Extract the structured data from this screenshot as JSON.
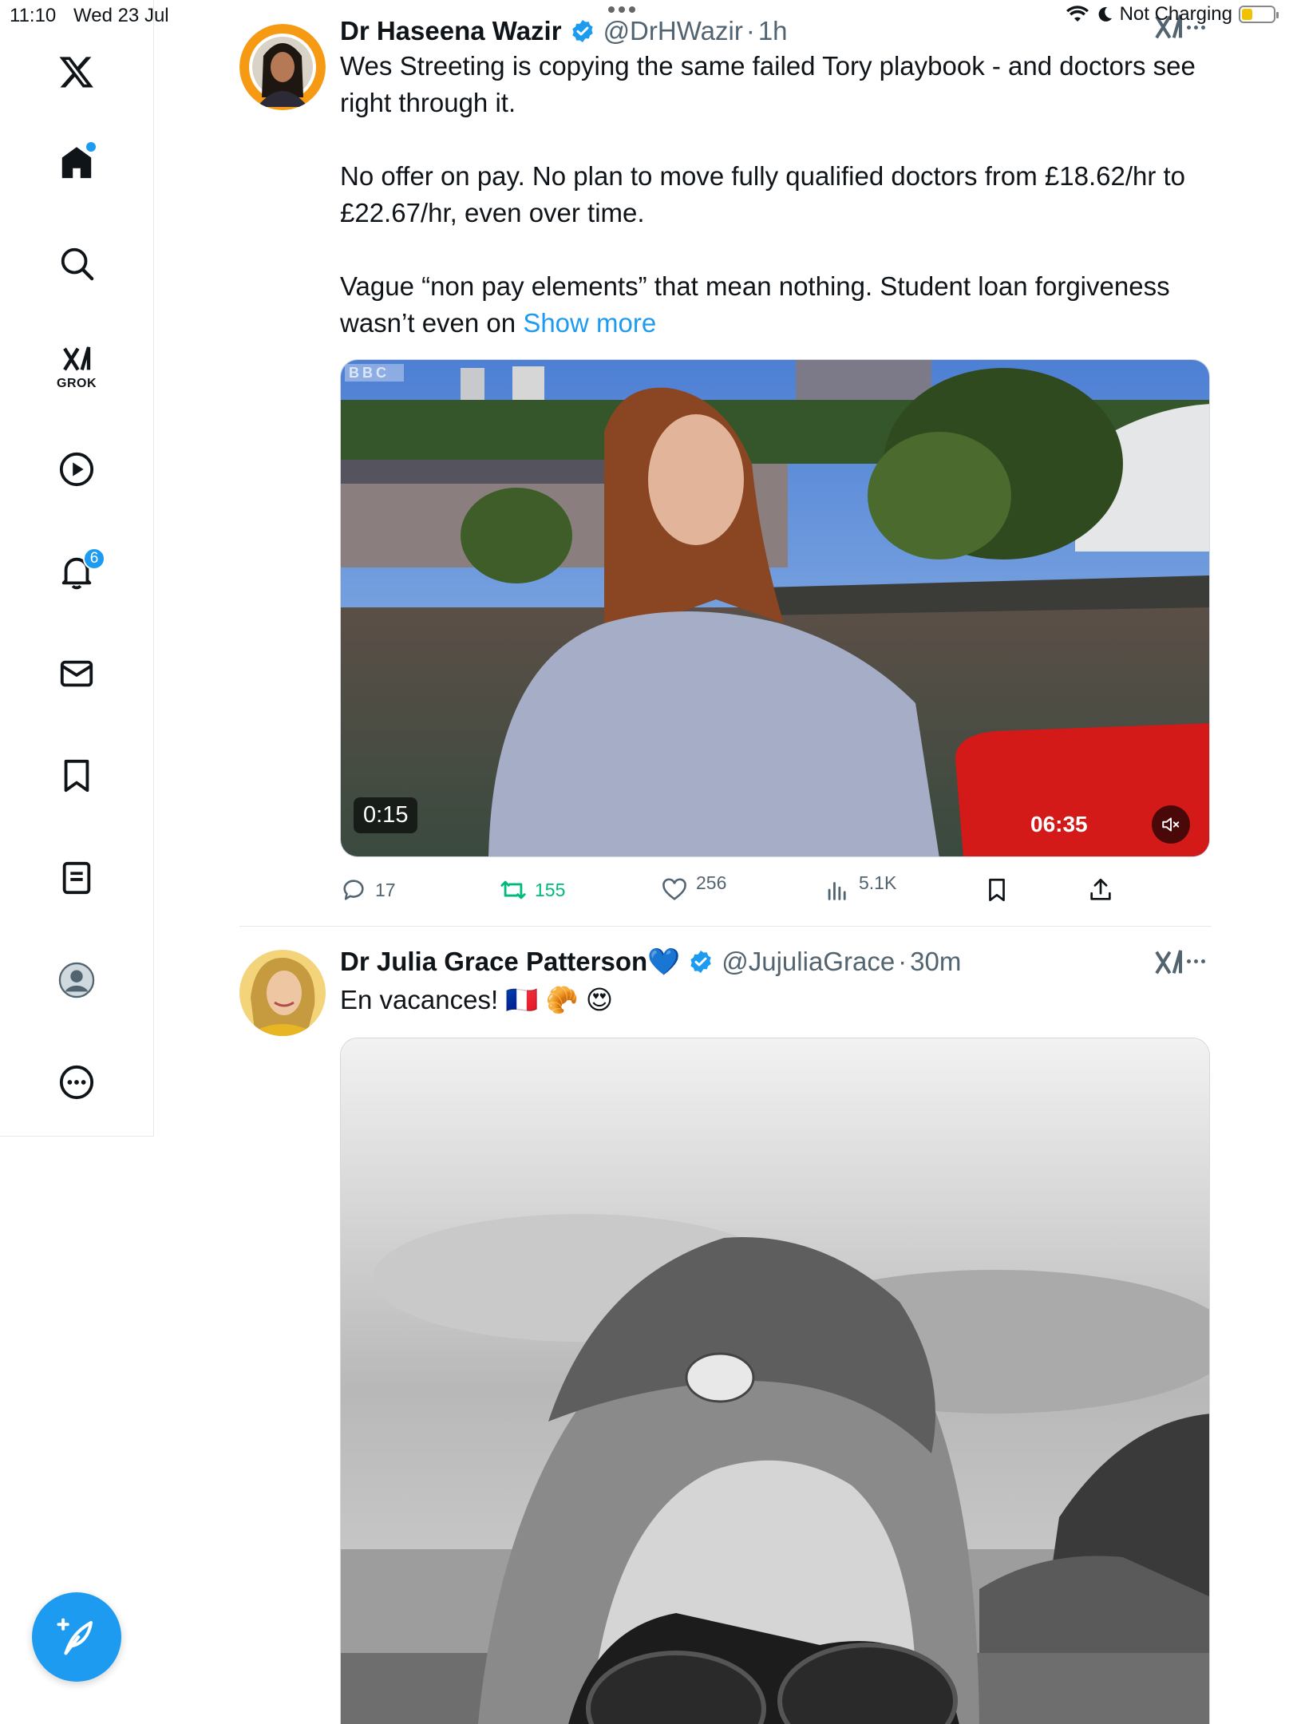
{
  "status_bar": {
    "time": "11:10",
    "date": "Wed 23 Jul",
    "charging": "Not Charging",
    "battery_level": 0.35,
    "battery_color": "#f2c200"
  },
  "sidebar": {
    "items": [
      {
        "name": "x-logo-icon"
      },
      {
        "name": "home-icon",
        "has_dot": true
      },
      {
        "name": "search-icon"
      },
      {
        "name": "grok-icon",
        "label": "GROK"
      },
      {
        "name": "video-play-icon"
      },
      {
        "name": "notifications-bell-icon",
        "badge": "6"
      },
      {
        "name": "mail-icon"
      },
      {
        "name": "bookmark-icon"
      },
      {
        "name": "lists-icon"
      },
      {
        "name": "profile-icon"
      },
      {
        "name": "more-icon"
      }
    ],
    "compose_icon": "compose-feather-icon",
    "accent": "#1d9bf0"
  },
  "tweets": [
    {
      "name": "Dr Haseena Wazir",
      "handle": "@DrHWazir",
      "time": "1h",
      "verified": true,
      "paragraphs": [
        "Wes Streeting is copying the same failed Tory playbook - and doctors see right through it.",
        "No offer on pay. No plan to move fully qualified doctors from £18.62/hr to £22.67/hr, even over time.",
        "Vague “non pay elements” that mean nothing. Student loan forgiveness wasn’t even on"
      ],
      "show_more": "Show more",
      "video": {
        "elapsed": "0:15",
        "duration": "06:35",
        "watermark": "BBC",
        "muted": true
      },
      "stats": {
        "replies": "17",
        "reposts": "155",
        "likes": "256",
        "views": "5.1K"
      }
    },
    {
      "name": "Dr Julia Grace Patterson💙",
      "handle": "@JujuliaGrace",
      "time": "30m",
      "verified": true,
      "text": "En vacances! 🇫🇷 🥐 😍"
    }
  ],
  "colors": {
    "accent": "#1d9bf0",
    "repost": "#00ba7c",
    "secondary_text": "#536471",
    "border": "#e6e9ec"
  }
}
